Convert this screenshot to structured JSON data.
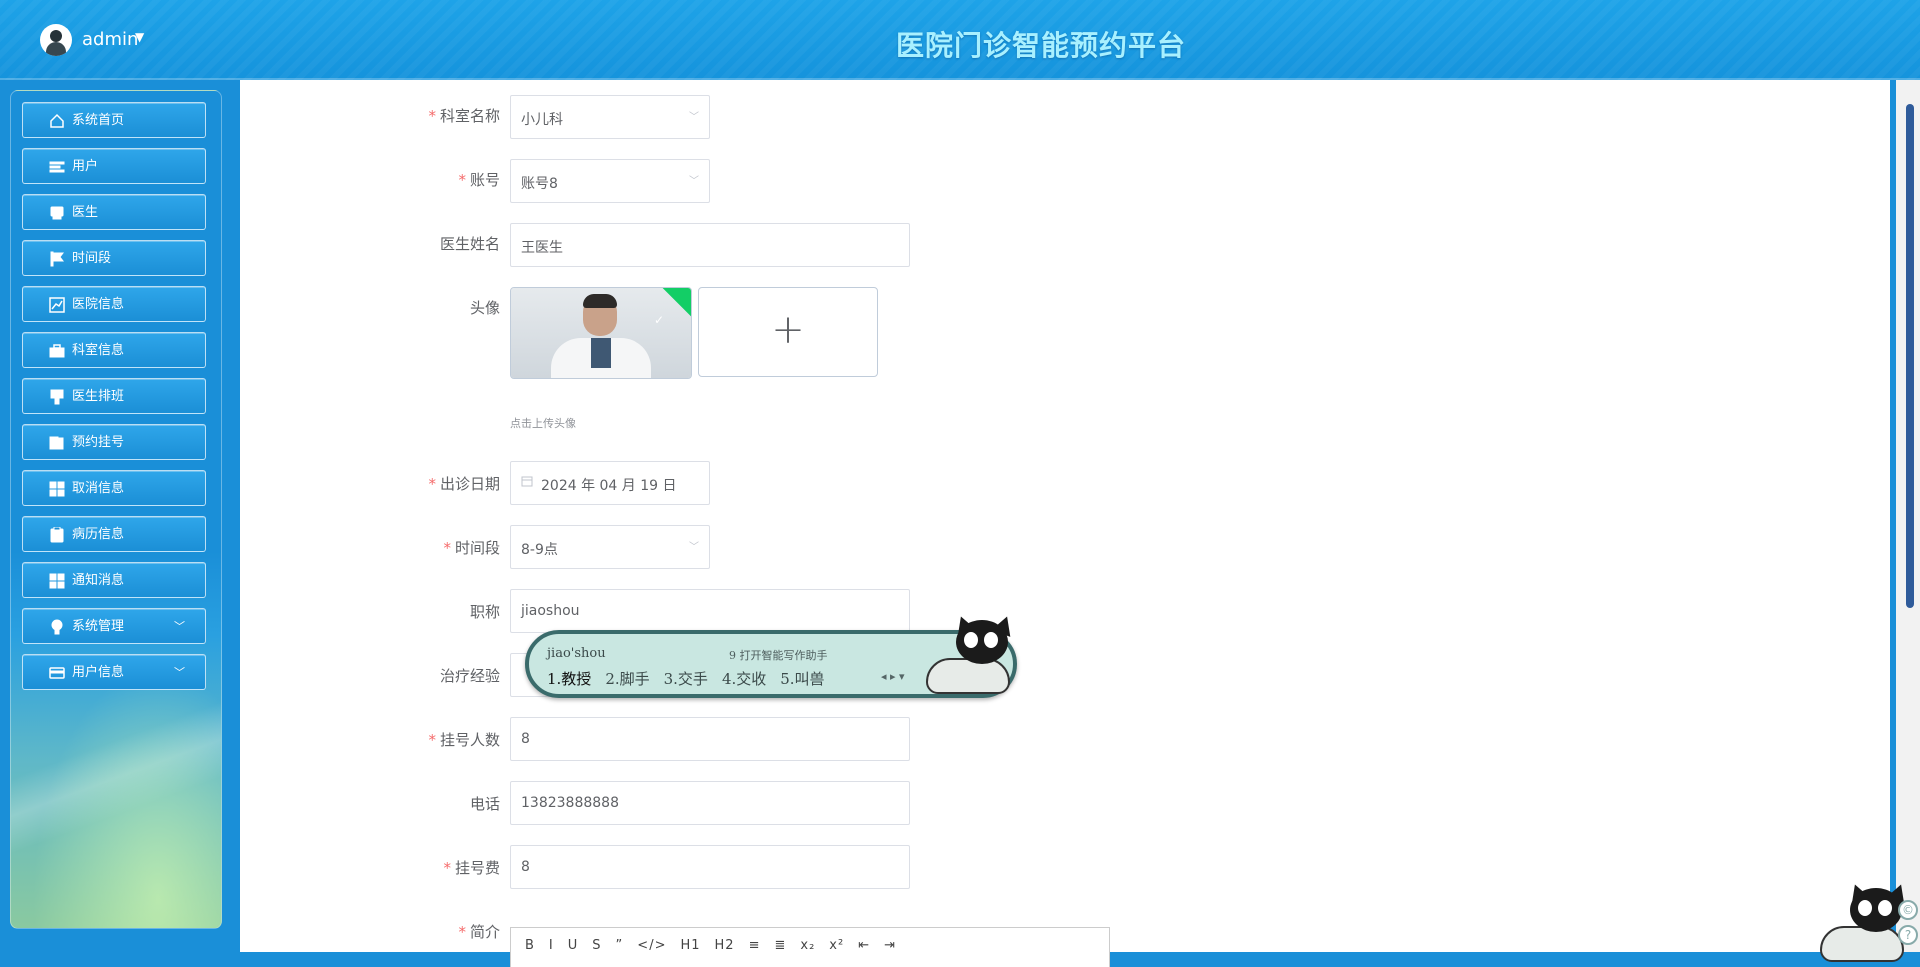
{
  "header": {
    "user_name": "admin",
    "app_title": "医院门诊智能预约平台"
  },
  "sidebar": {
    "items": [
      {
        "label": "系统首页",
        "icon": "home-icon"
      },
      {
        "label": "用户",
        "icon": "list-icon"
      },
      {
        "label": "医生",
        "icon": "monitor-icon"
      },
      {
        "label": "时间段",
        "icon": "flag-icon"
      },
      {
        "label": "医院信息",
        "icon": "chart-icon"
      },
      {
        "label": "科室信息",
        "icon": "briefcase-icon"
      },
      {
        "label": "医生排班",
        "icon": "brush-icon"
      },
      {
        "label": "预约挂号",
        "icon": "books-icon"
      },
      {
        "label": "取消信息",
        "icon": "grid-icon"
      },
      {
        "label": "病历信息",
        "icon": "clipboard-icon"
      },
      {
        "label": "通知消息",
        "icon": "grid-icon"
      },
      {
        "label": "系统管理",
        "icon": "bulb-icon",
        "expandable": true
      },
      {
        "label": "用户信息",
        "icon": "card-icon",
        "expandable": true
      }
    ]
  },
  "form": {
    "department": {
      "label": "科室名称",
      "value": "小儿科",
      "required": true
    },
    "account": {
      "label": "账号",
      "value": "账号8",
      "required": true
    },
    "doctor_name": {
      "label": "医生姓名",
      "value": "王医生",
      "required": false
    },
    "avatar": {
      "label": "头像",
      "hint": "点击上传头像"
    },
    "visit_date": {
      "label": "出诊日期",
      "value": "2024 年 04 月 19 日",
      "required": true
    },
    "time_slot": {
      "label": "时间段",
      "value": "8-9点",
      "required": true
    },
    "title": {
      "label": "职称",
      "value": "jiaoshou"
    },
    "experience": {
      "label": "治疗经验"
    },
    "quota": {
      "label": "挂号人数",
      "value": "8",
      "required": true
    },
    "phone": {
      "label": "电话",
      "value": "13823888888"
    },
    "fee": {
      "label": "挂号费",
      "value": "8",
      "required": true
    },
    "intro": {
      "label": "简介",
      "required": true
    }
  },
  "ime": {
    "pinyin": "jiao'shou",
    "tip": "9 打开智能写作助手",
    "candidates": [
      "1.教授",
      "2.脚手",
      "3.交手",
      "4.交收",
      "5.叫兽"
    ]
  },
  "editor": {
    "tools": [
      "B",
      "I",
      "U",
      "S",
      "”",
      "</>",
      "H1",
      "H2",
      "≡",
      "≣",
      "x₂",
      "x²",
      "⇤",
      "⇥"
    ]
  },
  "colors": {
    "primary": "#1a8fd8",
    "title": "#a8f0ff",
    "required": "#f56c6c",
    "success": "#13ce66"
  }
}
